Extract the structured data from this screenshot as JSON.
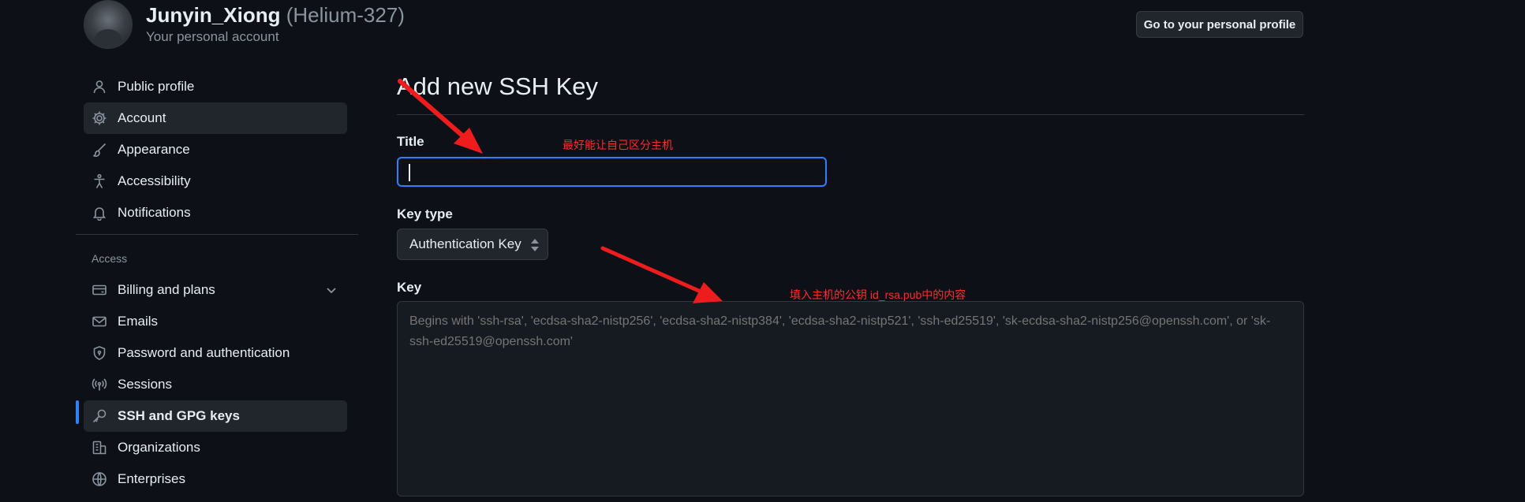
{
  "account": {
    "name": "Junyin_Xiong",
    "login": "(Helium-327)",
    "subtitle": "Your personal account",
    "profile_button": "Go to your personal profile"
  },
  "sidebar": {
    "items": [
      {
        "label": "Public profile",
        "icon": "person-icon"
      },
      {
        "label": "Account",
        "icon": "gear-icon"
      },
      {
        "label": "Appearance",
        "icon": "paintbrush-icon"
      },
      {
        "label": "Accessibility",
        "icon": "accessibility-icon"
      },
      {
        "label": "Notifications",
        "icon": "bell-icon"
      }
    ],
    "access_label": "Access",
    "access_items": [
      {
        "label": "Billing and plans",
        "icon": "credit-card-icon"
      },
      {
        "label": "Emails",
        "icon": "mail-icon"
      },
      {
        "label": "Password and authentication",
        "icon": "shield-lock-icon"
      },
      {
        "label": "Sessions",
        "icon": "broadcast-icon"
      },
      {
        "label": "SSH and GPG keys",
        "icon": "key-icon"
      },
      {
        "label": "Organizations",
        "icon": "organization-icon"
      },
      {
        "label": "Enterprises",
        "icon": "globe-icon"
      }
    ]
  },
  "main": {
    "title": "Add new SSH Key",
    "title_field": {
      "label": "Title",
      "value": "",
      "placeholder": ""
    },
    "key_type": {
      "label": "Key type",
      "selected": "Authentication Key"
    },
    "key_field": {
      "label": "Key",
      "placeholder": "Begins with 'ssh-rsa', 'ecdsa-sha2-nistp256', 'ecdsa-sha2-nistp384', 'ecdsa-sha2-nistp521', 'ssh-ed25519', 'sk-ecdsa-sha2-nistp256@openssh.com', or 'sk-ssh-ed25519@openssh.com'"
    }
  },
  "annotations": {
    "title_note": "最好能让自己区分主机",
    "key_note": "填入主机的公钥 id_rsa.pub中的内容"
  },
  "colors": {
    "background": "#0d1117",
    "accent": "#2f81f7",
    "annotation": "#ff2a2a"
  }
}
